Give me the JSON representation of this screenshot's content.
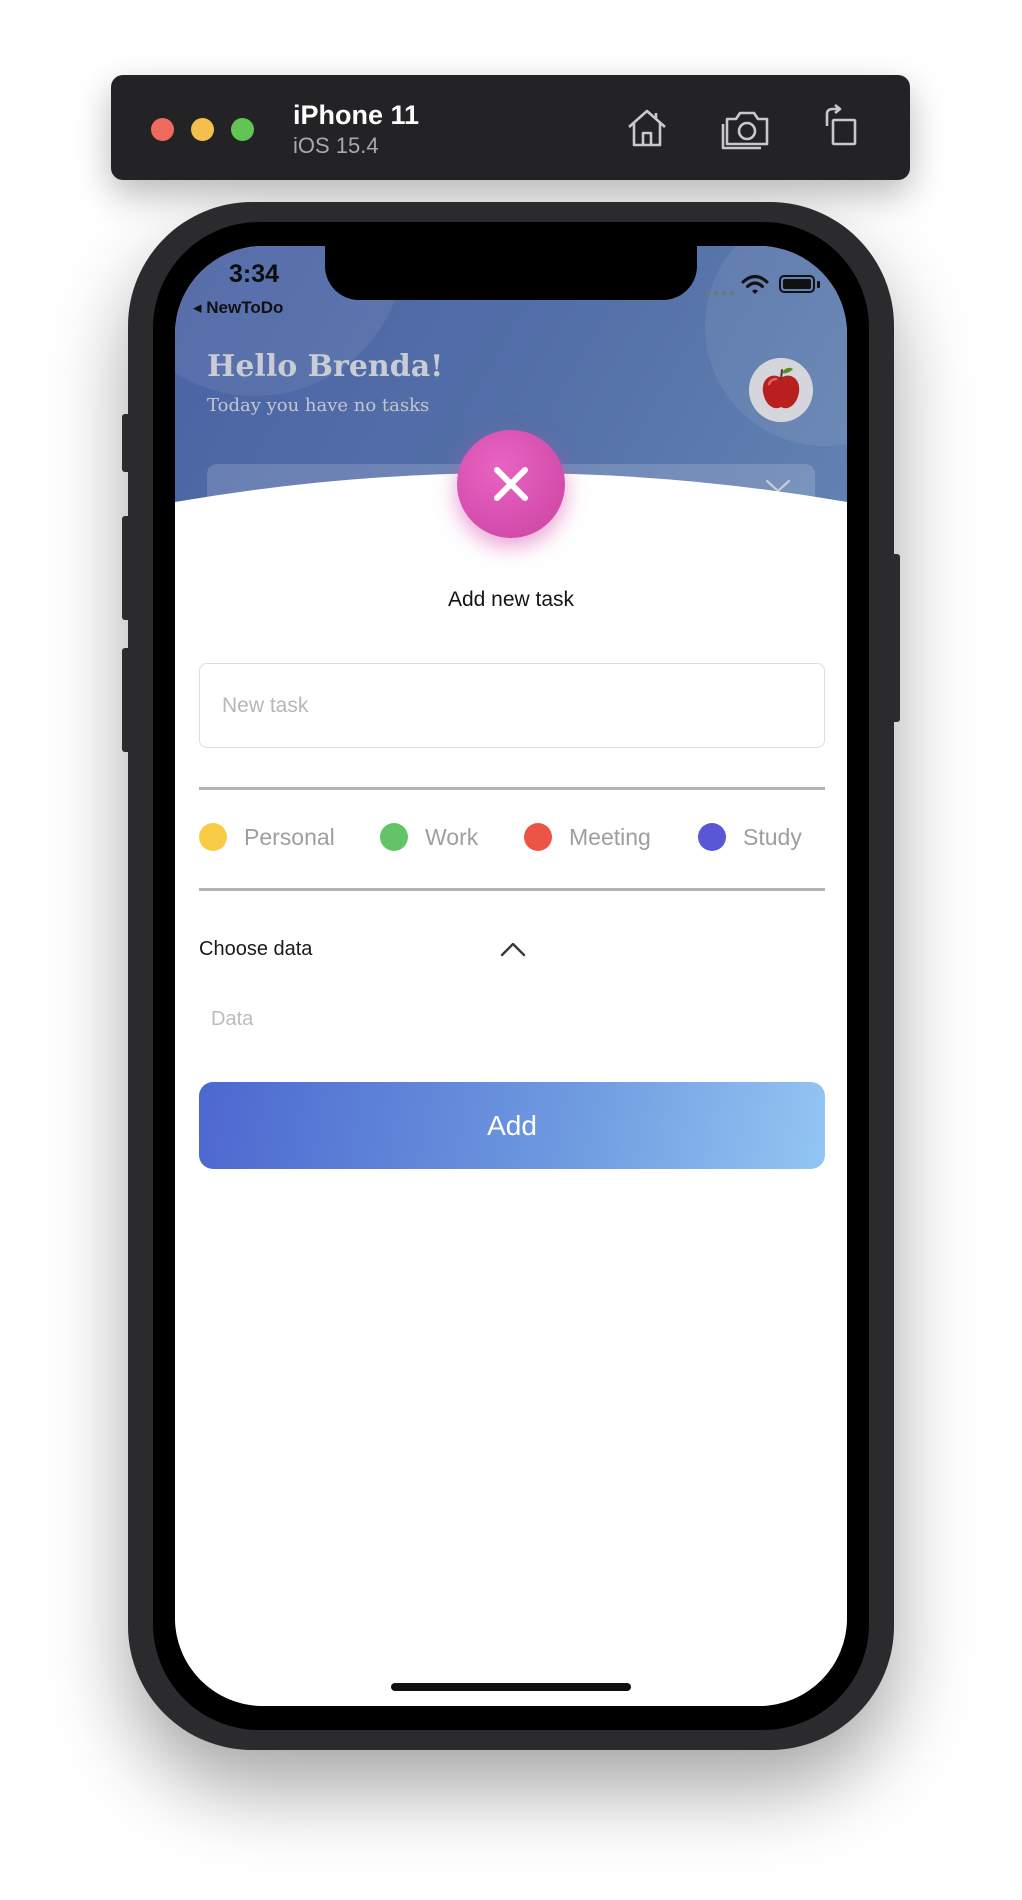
{
  "simulator": {
    "device_name": "iPhone 11",
    "os_version": "iOS 15.4",
    "icons": [
      "home-icon",
      "screenshot-icon",
      "rotate-icon"
    ]
  },
  "status_bar": {
    "time": "3:34",
    "back_label": "◂ NewToDo"
  },
  "header": {
    "greeting": "Hello Brenda!",
    "subtitle": "Today you have no tasks",
    "avatar_icon": "apple-icon"
  },
  "sheet": {
    "title": "Add new task",
    "task_placeholder": "New task",
    "categories": [
      {
        "label": "Personal",
        "color": "#f9cc45"
      },
      {
        "label": "Work",
        "color": "#63c467"
      },
      {
        "label": "Meeting",
        "color": "#ec5546"
      },
      {
        "label": "Study",
        "color": "#5957d6"
      }
    ],
    "choose_label": "Choose data",
    "data_placeholder": "Data",
    "add_label": "Add"
  },
  "colors": {
    "header_blue": "#4f6aa6",
    "close_pink": "#d64fae",
    "add_gradient_start": "#4c68cf",
    "add_gradient_end": "#92c6f3"
  }
}
